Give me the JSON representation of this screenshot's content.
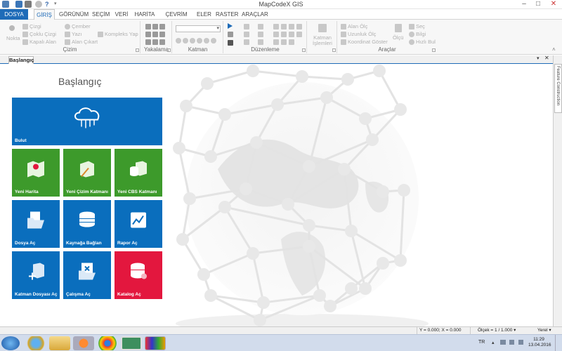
{
  "window": {
    "title": "MapCodeX GIS"
  },
  "tabs": {
    "dosya": "DOSYA",
    "giris": "GİRİŞ",
    "gorunum": "GÖRÜNÜM",
    "secim": "SEÇİM",
    "veri": "VERİ",
    "harita": "HARİTA",
    "cevrim_disi": "ÇEVRİM DIŞI",
    "eler": "ELER",
    "raster": "RASTER",
    "araclar": "ARAÇLAR"
  },
  "ribbon": {
    "cizim": {
      "label": "Çizim",
      "nokta": "Nokta",
      "cizgi": "Çizgi",
      "coklu_cizgi": "Çoklu Çizgi",
      "kapali_alan": "Kapalı Alan",
      "cember": "Çember",
      "yazi": "Yazı",
      "alan_cikart": "Alan Çıkart",
      "kompleks_yap": "Kompleks Yap"
    },
    "yakalama": {
      "label": "Yakalama"
    },
    "katman": {
      "label": "Katman"
    },
    "duzenleme": {
      "label": "Düzenleme"
    },
    "katman_islemleri": {
      "label": "Katman İşlemleri"
    },
    "araclar": {
      "label": "Araçlar",
      "alan_olc": "Alan Ölç",
      "uzunluk_olc": "Uzunluk Ölç",
      "koordinat_goster": "Koordinat Göster",
      "olcu": "Ölçü",
      "sec": "Seç",
      "bilgi": "Bilgi",
      "hizli_bul": "Hızlı Bul"
    }
  },
  "doc_tab": {
    "label": "Başlangıç"
  },
  "page": {
    "title": "Başlangıç"
  },
  "tiles": {
    "bulut": "Bulut",
    "yeni_harita": "Yeni Harita",
    "yeni_cizim_katmani": "Yeni Çizim Katmanı",
    "yeni_cbs_katmani": "Yeni CBS Katmanı",
    "dosya_ac": "Dosya Aç",
    "kaynaga_baglan": "Kaynağa Bağlan",
    "rapor_ac": "Rapor Aç",
    "katman_dosyasi_ac": "Katman Dosyası Aç",
    "calisma_ac": "Çalışma Aç",
    "katalog_ac": "Katalog Aç"
  },
  "side_panel": {
    "label": "Feature Construction"
  },
  "status": {
    "coords": "Y = 0.000; X = 0.000",
    "scale": "Ölçek = 1 / 1.000",
    "layer": "Yerel"
  },
  "taskbar": {
    "lang": "TR",
    "time": "11:29",
    "date": "13.04.2016"
  },
  "colors": {
    "blue_tile": "#0a6ebd",
    "green_tile": "#3d9a2b",
    "red_tile": "#e3173e",
    "accent": "#1e6bb8"
  }
}
